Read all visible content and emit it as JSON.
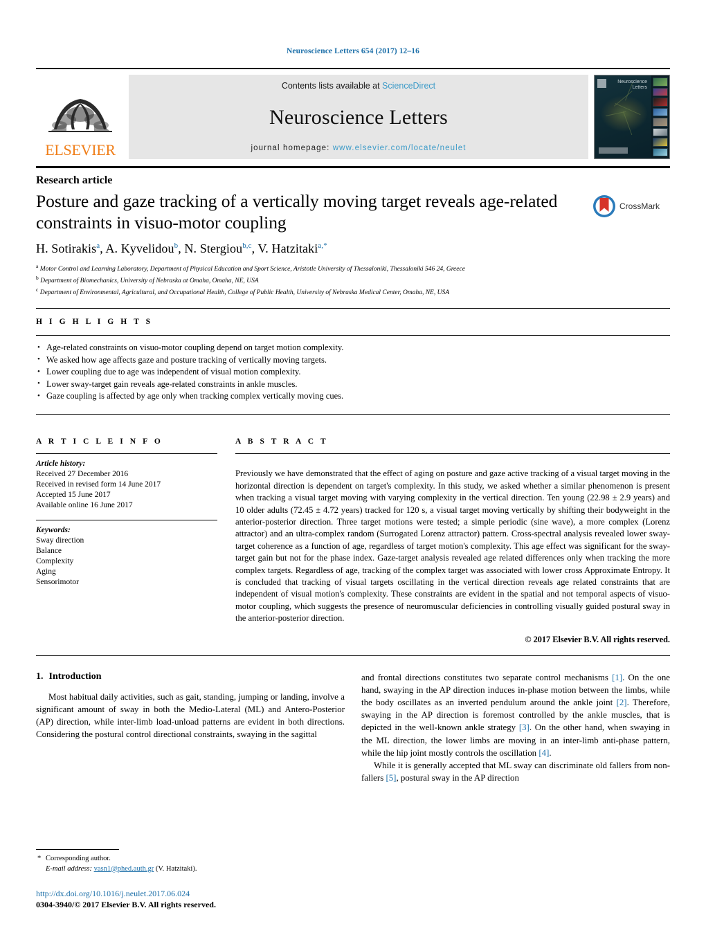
{
  "running_head": "Neuroscience Letters 654 (2017) 12–16",
  "masthead": {
    "publisher": "ELSEVIER",
    "contents_prefix": "Contents lists available at ",
    "contents_link": "ScienceDirect",
    "journal_name": "Neuroscience Letters",
    "homepage_prefix": "journal homepage: ",
    "homepage_url": "www.elsevier.com/locate/neulet",
    "cover_title_line1": "Neuroscience",
    "cover_title_line2": "Letters"
  },
  "article": {
    "type": "Research article",
    "title": "Posture and gaze tracking of a vertically moving target reveals age-related constraints in visuo-motor coupling",
    "crossmark_label": "CrossMark",
    "authors_html": "H. Sotirakis<sup>a</sup>, A. Kyvelidou<sup>b</sup>, N. Stergiou<sup>b,c</sup>, V. Hatzitaki<sup>a,</sup><sup>*</sup>",
    "affiliations": [
      {
        "marker": "a",
        "text": "Motor Control and Learning Laboratory, Department of Physical Education and Sport Science, Aristotle University of Thessaloniki, Thessaloniki 546 24, Greece"
      },
      {
        "marker": "b",
        "text": "Department of Biomechanics, University of Nebraska at Omaha, Omaha, NE, USA"
      },
      {
        "marker": "c",
        "text": "Department of Environmental, Agricultural, and Occupational Health, College of Public Health, University of Nebraska Medical Center, Omaha, NE, USA"
      }
    ]
  },
  "highlights": {
    "label": "H I G H L I G H T S",
    "items": [
      "Age-related constraints on visuo-motor coupling depend on target motion complexity.",
      "We asked how age affects gaze and posture tracking of vertically moving targets.",
      "Lower coupling due to age was independent of visual motion complexity.",
      "Lower sway-target gain reveals age-related constraints in ankle muscles.",
      "Gaze coupling is affected by age only when tracking complex vertically moving cues."
    ]
  },
  "article_info": {
    "label": "A R T I C L E   I N F O",
    "history_label": "Article history:",
    "history": [
      "Received 27 December 2016",
      "Received in revised form 14 June 2017",
      "Accepted 15 June 2017",
      "Available online 16 June 2017"
    ],
    "keywords_label": "Keywords:",
    "keywords": [
      "Sway direction",
      "Balance",
      "Complexity",
      "Aging",
      "Sensorimotor"
    ]
  },
  "abstract": {
    "label": "A B S T R A C T",
    "text": "Previously we have demonstrated that the effect of aging on posture and gaze active tracking of a visual target moving in the horizontal direction is dependent on target's complexity. In this study, we asked whether a similar phenomenon is present when tracking a visual target moving with varying complexity in the vertical direction. Ten young (22.98 ± 2.9 years) and 10 older adults (72.45 ± 4.72 years) tracked for 120 s, a visual target moving vertically by shifting their bodyweight in the anterior-posterior direction. Three target motions were tested; a simple periodic (sine wave), a more complex (Lorenz attractor) and an ultra-complex random (Surrogated Lorenz attractor) pattern. Cross-spectral analysis revealed lower sway-target coherence as a function of age, regardless of target motion's complexity. This age effect was significant for the sway-target gain but not for the phase index. Gaze-target analysis revealed age related differences only when tracking the more complex targets. Regardless of age, tracking of the complex target was associated with lower cross Approximate Entropy. It is concluded that tracking of visual targets oscillating in the vertical direction reveals age related constraints that are independent of visual motion's complexity. These constraints are evident in the spatial and not temporal aspects of visuo-motor coupling, which suggests the presence of neuromuscular deficiencies in controlling visually guided postural sway in the anterior-posterior direction.",
    "copyright": "© 2017 Elsevier B.V. All rights reserved."
  },
  "introduction": {
    "number": "1.",
    "heading": "Introduction",
    "left_paragraph": "Most habitual daily activities, such as gait, standing, jumping or landing, involve a significant amount of sway in both the Medio-Lateral (ML) and Antero-Posterior (AP) direction, while inter-limb load-unload patterns are evident in both directions. Considering the postural control directional constraints, swaying in the sagittal",
    "right_paragraph_1_a": "and frontal directions constitutes two separate control mechanisms ",
    "ref1": "[1]",
    "right_paragraph_1_b": ". On the one hand, swaying in the AP direction induces in-phase motion between the limbs, while the body oscillates as an inverted pendulum around the ankle joint ",
    "ref2": "[2]",
    "right_paragraph_1_c": ". Therefore, swaying in the AP direction is foremost controlled by the ankle muscles, that is depicted in the well-known ankle strategy ",
    "ref3": "[3]",
    "right_paragraph_1_d": ". On the other hand, when swaying in the ML direction, the lower limbs are moving in an inter-limb anti-phase pattern, while the hip joint mostly controls the oscillation ",
    "ref4": "[4]",
    "right_paragraph_1_e": ".",
    "right_paragraph_2_a": "While it is generally accepted that ML sway can discriminate old fallers from non-fallers ",
    "ref5": "[5]",
    "right_paragraph_2_b": ", postural sway in the AP direction"
  },
  "footnotes": {
    "corresponding_marker": "*",
    "corresponding_text": "Corresponding author.",
    "email_label": "E-mail address:",
    "email": "vasn1@phed.auth.gr",
    "email_suffix": "(V. Hatzitaki).",
    "doi": "http://dx.doi.org/10.1016/j.neulet.2017.06.024",
    "issn": "0304-3940/© 2017 Elsevier B.V. All rights reserved."
  },
  "colors": {
    "link_blue": "#1a6ea8",
    "sciencedirect_blue": "#3C9BC8",
    "elsevier_orange": "#F07F1A",
    "crossmark_blue": "#2B7BBA",
    "crossmark_red": "#D6352B"
  }
}
